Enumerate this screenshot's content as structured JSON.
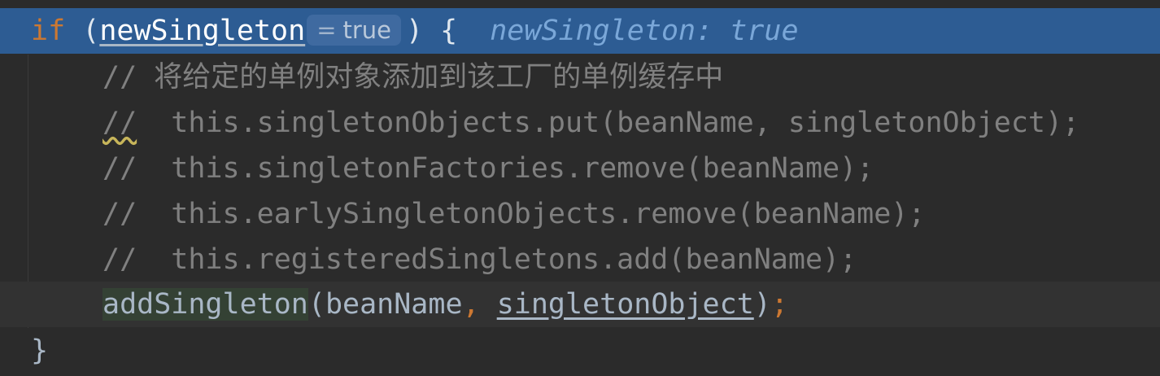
{
  "code": {
    "line1": {
      "keyword": "if",
      "open_paren": " (",
      "variable": "newSingleton",
      "hint_eq": "=",
      "hint_value": "true",
      "close": ") {",
      "inline_debug": "newSingleton: true"
    },
    "line2": {
      "comment_prefix": "// ",
      "comment_text": "将给定的单例对象添加到该工厂的单例缓存中"
    },
    "line3": {
      "comment_prefix": "//",
      "comment_text": "  this.singletonObjects.put(beanName, singletonObject);"
    },
    "line4": {
      "comment": "//  this.singletonFactories.remove(beanName);"
    },
    "line5": {
      "comment": "//  this.earlySingletonObjects.remove(beanName);"
    },
    "line6": {
      "comment": "//  this.registeredSingletons.add(beanName);"
    },
    "line7": {
      "method": "addSingleton",
      "open": "(beanName",
      "comma": ",",
      "arg2": "singletonObject",
      "close": ")",
      "semicolon": ";"
    },
    "line8": {
      "brace": "}"
    }
  },
  "colors": {
    "background": "#2b2b2b",
    "execution_line": "#2d5c93",
    "current_line": "#323232",
    "keyword": "#cc7832",
    "comment": "#808080",
    "text": "#a9b7c6"
  }
}
